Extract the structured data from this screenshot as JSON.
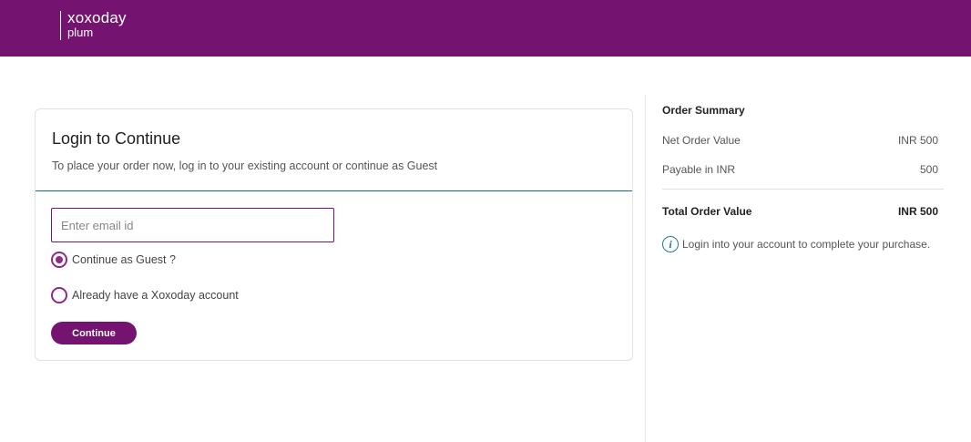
{
  "header": {
    "logo_word": "xoxoday",
    "logo_sub": "plum"
  },
  "login": {
    "title": "Login to Continue",
    "subtitle": "To place your order now, log in to your existing account or continue as Guest",
    "email_placeholder": "Enter email id",
    "email_value": "",
    "options": [
      {
        "label": "Continue as Guest ?",
        "selected": true
      },
      {
        "label": "Already have a Xoxoday account",
        "selected": false
      }
    ],
    "continue_label": "Continue"
  },
  "summary": {
    "title": "Order Summary",
    "rows": [
      {
        "label": "Net Order Value",
        "value": "INR 500"
      },
      {
        "label": "Payable in INR",
        "value": "500"
      }
    ],
    "total_label": "Total Order Value",
    "total_value": "INR 500",
    "info_icon": "i",
    "info_text": "Login into your account to complete your purchase."
  },
  "colors": {
    "brand": "#741470",
    "divider_accent": "#0f6e75",
    "info": "#1c7c9e"
  }
}
